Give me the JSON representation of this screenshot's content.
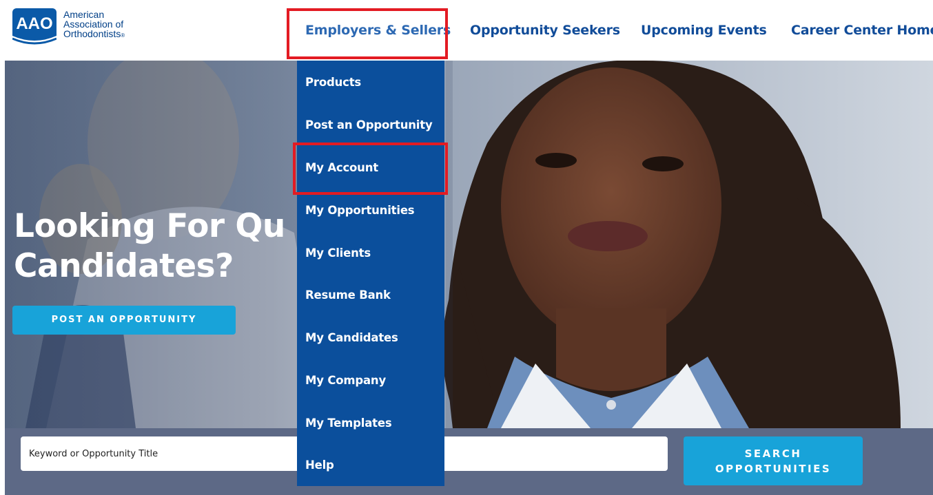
{
  "logo": {
    "abbr": "AAO",
    "line1": "American",
    "line2": "Association of",
    "line3": "Orthodontists",
    "mark": "®"
  },
  "nav": {
    "items": [
      {
        "label": "Employers & Sellers"
      },
      {
        "label": "Opportunity Seekers"
      },
      {
        "label": "Upcoming Events"
      },
      {
        "label": "Career Center Home"
      }
    ]
  },
  "dropdown": {
    "items": [
      {
        "label": "Products"
      },
      {
        "label": "Post an Opportunity"
      },
      {
        "label": "My Account"
      },
      {
        "label": "My Opportunities"
      },
      {
        "label": "My Clients"
      },
      {
        "label": "Resume Bank"
      },
      {
        "label": "My Candidates"
      },
      {
        "label": "My Company"
      },
      {
        "label": "My Templates"
      },
      {
        "label": "Help"
      }
    ]
  },
  "hero": {
    "headline_line1": "Looking For Qu",
    "headline_line2": "Candidates?",
    "button_label": "POST AN OPPORTUNITY"
  },
  "search": {
    "placeholder": "Keyword or Opportunity Title",
    "button_line1": "SEARCH",
    "button_line2": "OPPORTUNITIES"
  },
  "colors": {
    "nav_text": "#114c99",
    "dropdown_bg": "#0b4f9c",
    "accent_button": "#18a3d9",
    "highlight_border": "#e31b23",
    "search_band": "#5d6986"
  }
}
